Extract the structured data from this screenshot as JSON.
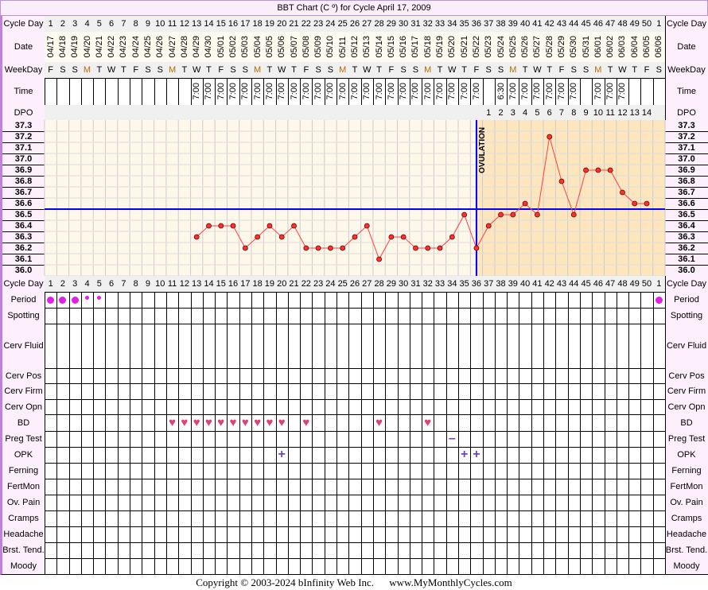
{
  "title": "BBT Chart (C º) for Cycle April 17, 2009",
  "labels": {
    "cycle_day": "Cycle Day",
    "date": "Date",
    "weekday": "WeekDay",
    "time": "Time",
    "dpo": "DPO",
    "ovulation": "OVULATION"
  },
  "cycle_days": [
    "1",
    "2",
    "3",
    "4",
    "5",
    "6",
    "7",
    "8",
    "9",
    "10",
    "11",
    "12",
    "13",
    "14",
    "15",
    "16",
    "17",
    "18",
    "19",
    "20",
    "21",
    "22",
    "23",
    "24",
    "25",
    "26",
    "27",
    "28",
    "29",
    "30",
    "31",
    "32",
    "33",
    "34",
    "35",
    "36",
    "37",
    "38",
    "39",
    "40",
    "41",
    "42",
    "43",
    "44",
    "45",
    "46",
    "47",
    "48",
    "49",
    "50",
    "1"
  ],
  "dates": [
    "04/17",
    "04/18",
    "04/19",
    "04/20",
    "04/21",
    "04/22",
    "04/23",
    "04/24",
    "04/25",
    "04/26",
    "04/27",
    "04/28",
    "04/29",
    "04/30",
    "05/01",
    "05/02",
    "05/03",
    "05/04",
    "05/05",
    "05/06",
    "05/07",
    "05/08",
    "05/09",
    "05/10",
    "05/11",
    "05/12",
    "05/13",
    "05/14",
    "05/15",
    "05/16",
    "05/17",
    "05/18",
    "05/19",
    "05/20",
    "05/21",
    "05/22",
    "05/23",
    "05/24",
    "05/25",
    "05/26",
    "05/27",
    "05/28",
    "05/29",
    "05/30",
    "05/31",
    "06/01",
    "06/02",
    "06/03",
    "06/04",
    "06/05",
    "06/06"
  ],
  "weekdays": [
    "F",
    "S",
    "S",
    "M",
    "T",
    "W",
    "T",
    "F",
    "S",
    "S",
    "M",
    "T",
    "W",
    "T",
    "F",
    "S",
    "S",
    "M",
    "T",
    "W",
    "T",
    "F",
    "S",
    "S",
    "M",
    "T",
    "W",
    "T",
    "F",
    "S",
    "S",
    "M",
    "T",
    "W",
    "T",
    "F",
    "S",
    "S",
    "M",
    "T",
    "W",
    "T",
    "F",
    "S",
    "S",
    "M",
    "T",
    "W",
    "T",
    "F",
    "S"
  ],
  "times": [
    "",
    "",
    "",
    "",
    "",
    "",
    "",
    "",
    "",
    "",
    "",
    "",
    "7:00",
    "7:00",
    "7:00",
    "7:00",
    "7:00",
    "7:00",
    "7:00",
    "7:00",
    "7:00",
    "7:00",
    "7:00",
    "7:00",
    "7:00",
    "7:00",
    "7:00",
    "7:00",
    "7:00",
    "7:00",
    "7:00",
    "7:00",
    "7:00",
    "7:00",
    "7:00",
    "7:00",
    "",
    "6:30",
    "7:00",
    "7:00",
    "7:00",
    "7:00",
    "7:00",
    "7:00",
    "",
    "7:00",
    "7:00",
    "7:00",
    "",
    "",
    ""
  ],
  "dpo": [
    "",
    "",
    "",
    "",
    "",
    "",
    "",
    "",
    "",
    "",
    "",
    "",
    "",
    "",
    "",
    "",
    "",
    "",
    "",
    "",
    "",
    "",
    "",
    "",
    "",
    "",
    "",
    "",
    "",
    "",
    "",
    "",
    "",
    "",
    "",
    "",
    "1",
    "2",
    "3",
    "4",
    "5",
    "6",
    "7",
    "8",
    "9",
    "10",
    "11",
    "12",
    "13",
    "14",
    ""
  ],
  "chart_data": {
    "type": "line",
    "x_label": "Cycle Day",
    "y_ticks": [
      "37.3",
      "37.2",
      "37.1",
      "37.0",
      "36.9",
      "36.8",
      "36.7",
      "36.6",
      "36.5",
      "36.4",
      "36.3",
      "36.2",
      "36.1",
      "36.0"
    ],
    "ylim": [
      36.0,
      37.3
    ],
    "temps": [
      null,
      null,
      null,
      null,
      null,
      null,
      null,
      null,
      null,
      null,
      null,
      null,
      36.3,
      36.4,
      36.4,
      36.4,
      36.2,
      36.3,
      36.4,
      36.3,
      36.4,
      36.2,
      36.2,
      36.2,
      36.2,
      36.3,
      36.4,
      36.1,
      36.3,
      36.3,
      36.2,
      36.2,
      36.2,
      36.3,
      36.5,
      36.2,
      36.4,
      36.5,
      36.5,
      36.6,
      36.5,
      37.2,
      36.8,
      36.5,
      36.9,
      36.9,
      36.9,
      36.7,
      36.6,
      36.6,
      null
    ],
    "coverline": 36.55,
    "ovulation_day": 36,
    "colors": {
      "line": "#ff4040",
      "point": "#ff3030",
      "coverline": "#0000ff",
      "ovulation": "#0000ff",
      "luteal_shade": "#fde6bd",
      "follicular_bg": "#fdf8ea"
    }
  },
  "rows": [
    {
      "label": "Period",
      "marks": {
        "1": "dot-large",
        "2": "dot-large",
        "3": "dot-large",
        "4": "dot-small",
        "5": "dot-small",
        "51": "dot-large"
      }
    },
    {
      "label": "Spotting",
      "marks": {}
    },
    {
      "label": "Cerv Fluid",
      "marks": {}
    },
    {
      "label": "Cerv Pos",
      "marks": {}
    },
    {
      "label": "Cerv Firm",
      "marks": {}
    },
    {
      "label": "Cerv Opn",
      "marks": {}
    },
    {
      "label": "BD",
      "marks": {
        "11": "heart",
        "12": "heart",
        "13": "heart",
        "14": "heart",
        "15": "heart",
        "16": "heart",
        "17": "heart",
        "18": "heart",
        "19": "heart",
        "20": "heart",
        "22": "heart",
        "28": "heart",
        "32": "heart"
      }
    },
    {
      "label": "Preg Test",
      "marks": {
        "34": "minus"
      }
    },
    {
      "label": "OPK",
      "marks": {
        "20": "plus",
        "35": "plus",
        "36": "plus"
      }
    },
    {
      "label": "Ferning",
      "marks": {}
    },
    {
      "label": "FertMon",
      "marks": {}
    },
    {
      "label": "Ov. Pain",
      "marks": {}
    },
    {
      "label": "Cramps",
      "marks": {}
    },
    {
      "label": "Headache",
      "marks": {}
    },
    {
      "label": "Brst. Tend.",
      "marks": {}
    },
    {
      "label": "Moody",
      "marks": {}
    }
  ],
  "footer": {
    "copyright": "Copyright © 2003-2024 bInfinity Web Inc.",
    "site": "www.MyMonthlyCycles.com"
  }
}
